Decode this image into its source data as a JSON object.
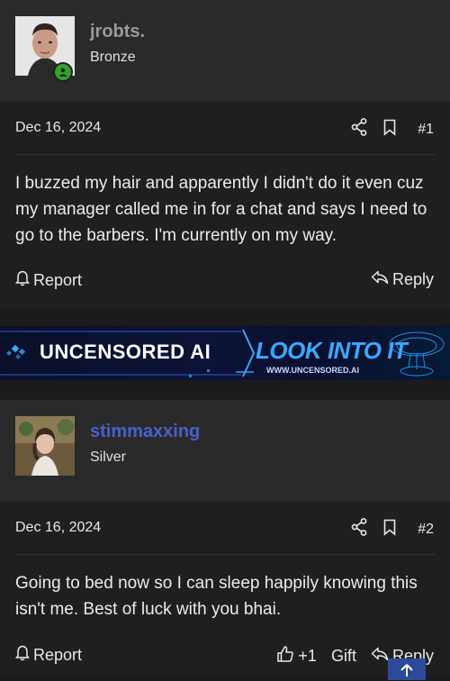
{
  "posts": [
    {
      "username": "jrobts.",
      "rank": "Bronze",
      "date": "Dec 16, 2024",
      "number": "#1",
      "message": "I buzzed my hair and apparently I didn't do it even cuz my manager called me in for a chat and says I need to go to the barbers. I'm currently on my way.",
      "report_label": "Report",
      "reply_label": "Reply",
      "username_color": "#9a9a9a"
    },
    {
      "username": "stimmaxxing",
      "rank": "Silver",
      "date": "Dec 16, 2024",
      "number": "#2",
      "message": "Going to bed now so I can sleep happily knowing this isn't me. Best of luck with you bhai.",
      "report_label": "Report",
      "like_count": "+1",
      "gift_label": "Gift",
      "reply_label": "Reply",
      "username_color": "#4a5fd0"
    }
  ],
  "banner": {
    "brand": "UNCENSORED AI",
    "tagline": "LOOK INTO IT",
    "url": "WWW.UNCENSORED.AI"
  },
  "icons": {
    "share": "share-icon",
    "bookmark": "bookmark-icon",
    "report": "bell-icon",
    "reply": "reply-icon",
    "like": "thumbs-up-icon",
    "scroll_top": "arrow-up-icon"
  }
}
